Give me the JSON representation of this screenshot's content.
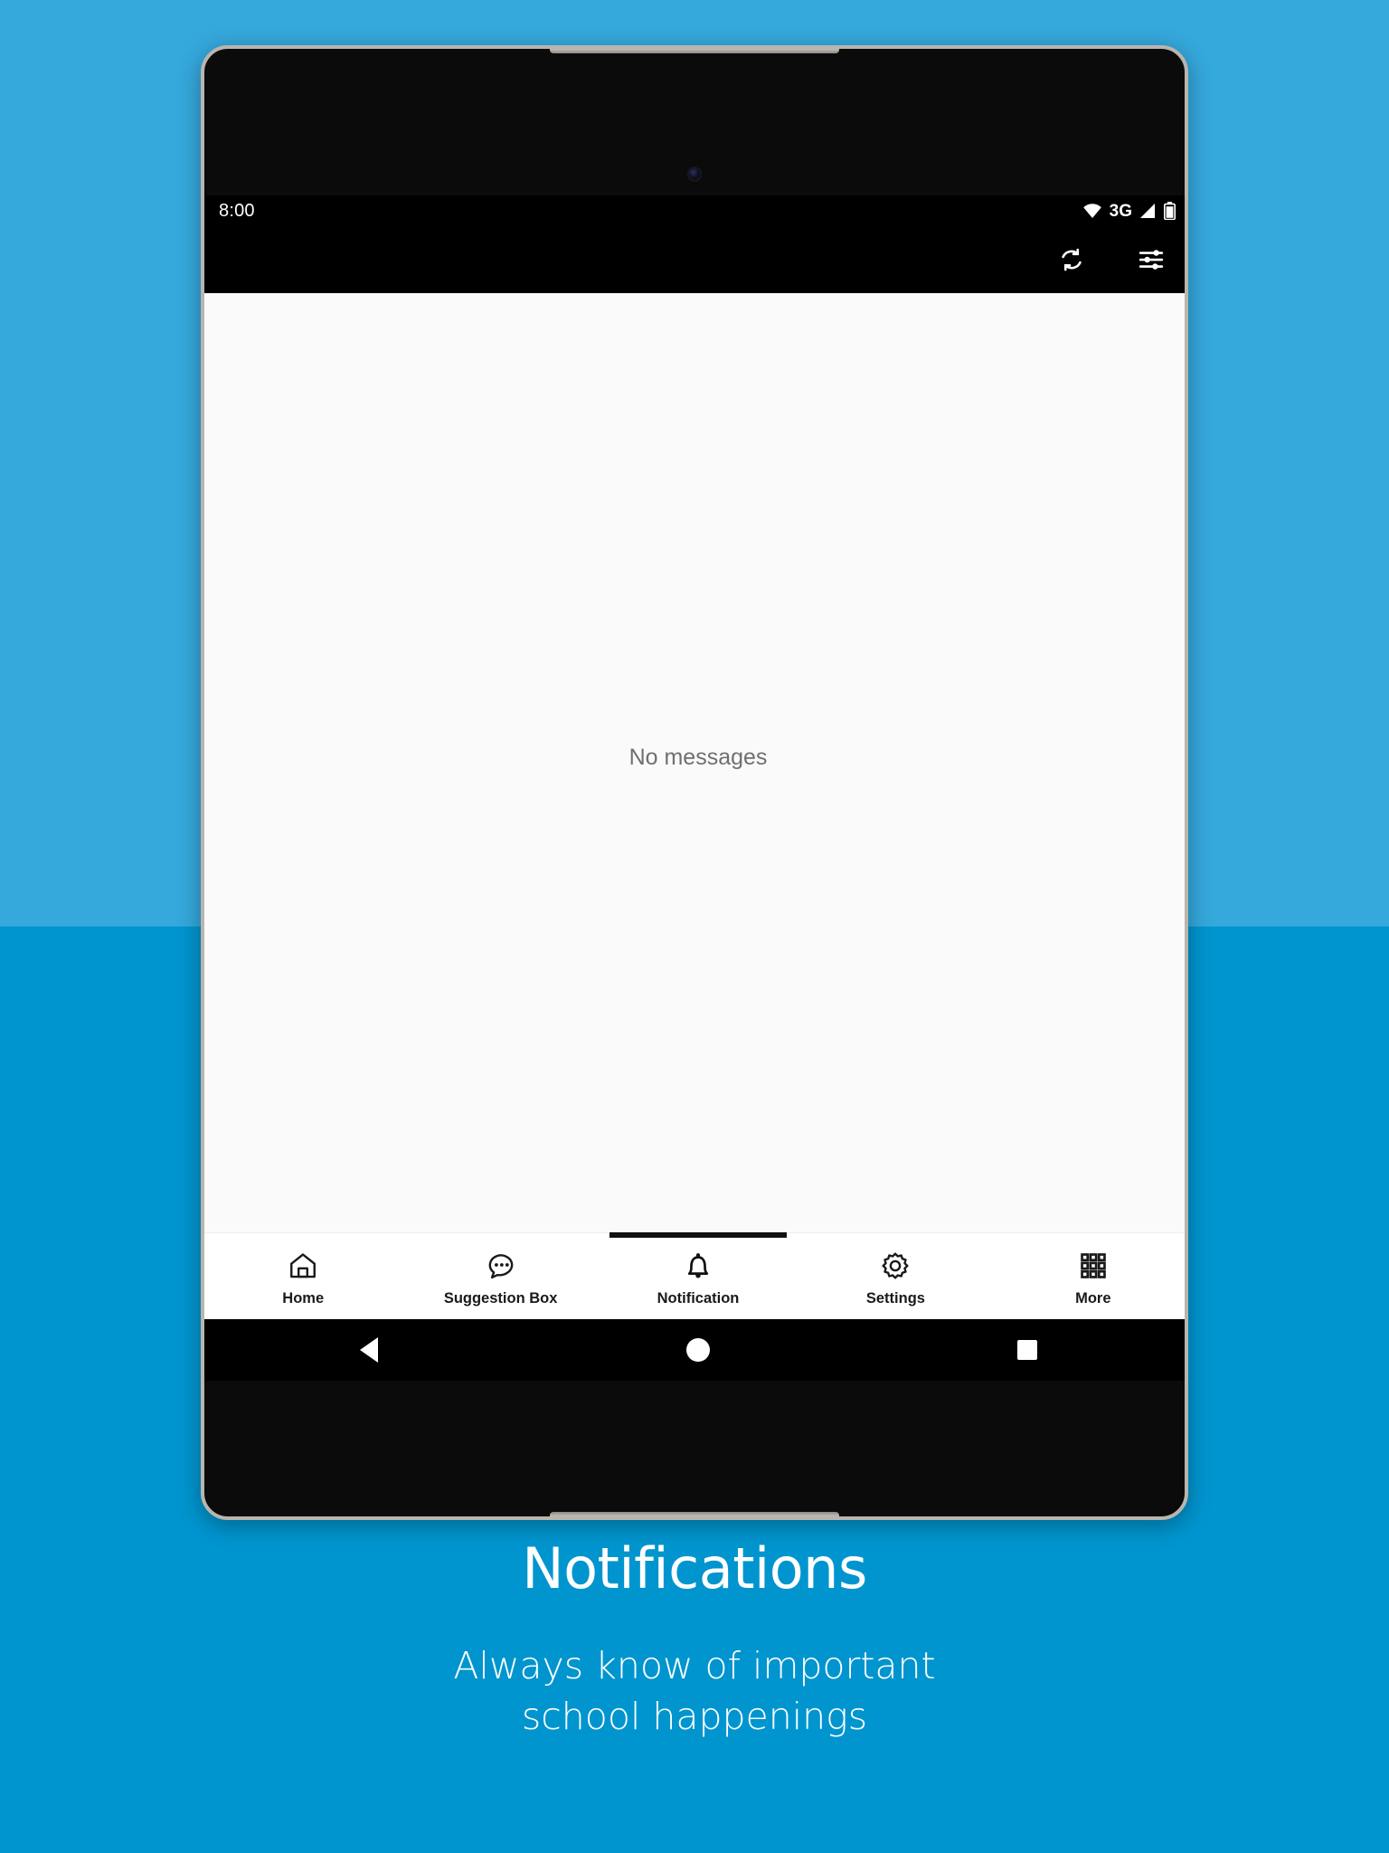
{
  "theme": {
    "bg_top": "#35a8dc",
    "bg_bottom": "#0095cf",
    "screen_bg": "#fafafa",
    "nav_bg": "#ffffff",
    "system_bar_bg": "#000000",
    "accent_text": "#ffffff",
    "muted_text": "#6f6f6f"
  },
  "status_bar": {
    "time": "8:00",
    "network_type": "3G",
    "icons": [
      "wifi-icon",
      "signal-icon",
      "battery-icon"
    ]
  },
  "app_toolbar": {
    "actions": [
      {
        "name": "refresh-icon",
        "label": "Refresh"
      },
      {
        "name": "filter-icon",
        "label": "Filter"
      }
    ]
  },
  "content": {
    "empty_state": "No messages"
  },
  "bottom_nav": {
    "active_index": 2,
    "items": [
      {
        "label": "Home",
        "icon": "home-icon"
      },
      {
        "label": "Suggestion Box",
        "icon": "chat-bubble-icon"
      },
      {
        "label": "Notification",
        "icon": "bell-icon"
      },
      {
        "label": "Settings",
        "icon": "gear-icon"
      },
      {
        "label": "More",
        "icon": "grid-icon"
      }
    ]
  },
  "system_nav": {
    "buttons": [
      {
        "name": "back-button",
        "label": "Back"
      },
      {
        "name": "home-button",
        "label": "Home"
      },
      {
        "name": "recents-button",
        "label": "Recent apps"
      }
    ]
  },
  "caption": {
    "title": "Notifications",
    "subtitle_line1": "Always know of important",
    "subtitle_line2": "school happenings"
  }
}
